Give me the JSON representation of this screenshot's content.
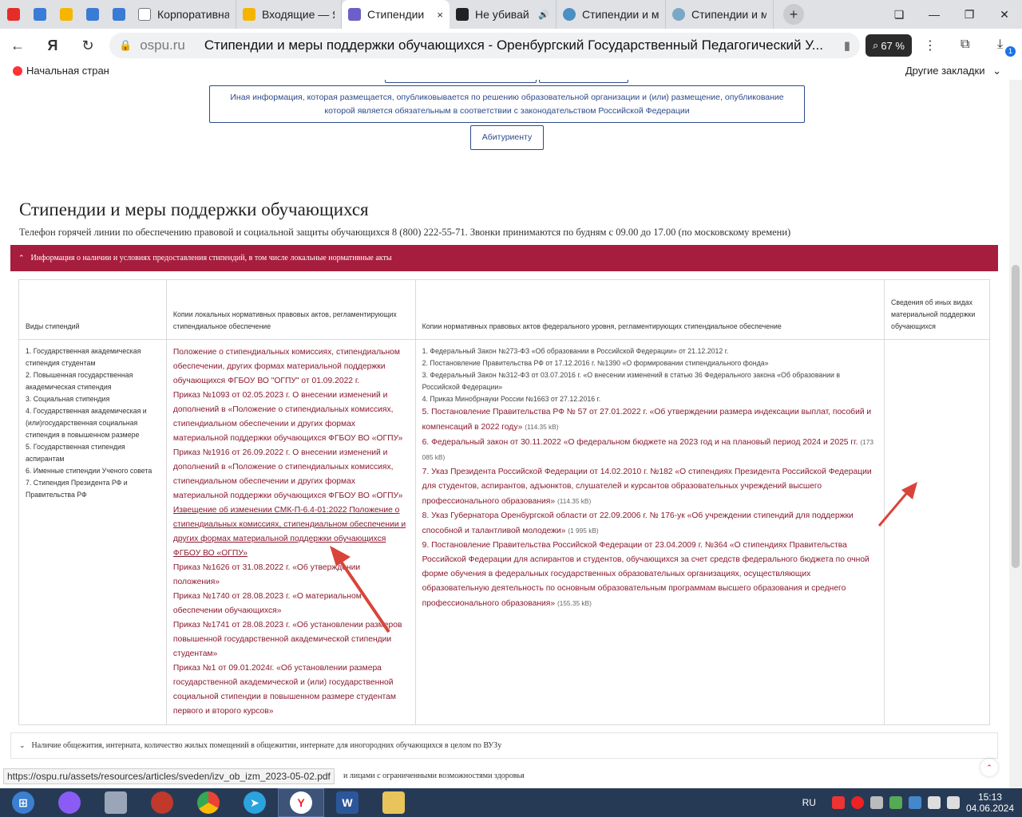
{
  "tabs": [
    {
      "title": "Корпоративна",
      "icon": "corporate-icon"
    },
    {
      "title": "Входящие — Я",
      "icon": "mail-icon"
    },
    {
      "title": "Стипендии",
      "icon": "ospu-icon",
      "close": "×"
    },
    {
      "title": "Не убивай",
      "icon": "video-icon"
    },
    {
      "title": "Стипендии и м",
      "icon": "scholarship-icon"
    },
    {
      "title": "Стипендии и м",
      "icon": "scholarship-icon"
    }
  ],
  "new_tab": "+",
  "window_controls": {
    "minimize": "—",
    "maximize": "❐",
    "close": "✕"
  },
  "address": {
    "domain": "ospu.ru",
    "title": "Стипендии и меры поддержки обучающихся - Оренбургский Государственный Педагогический У...",
    "zoom": "67 %"
  },
  "downloads_count": "1",
  "bookmarks": {
    "home": "Начальная стран",
    "other": "Другие закладки"
  },
  "page": {
    "nav_other_info": "Иная информация, которая размещается, опубликовывается по решению образовательной организации и (или) размещение, опубликование которой является обязательным в соответствии с законодательством Российской Федерации",
    "nav_applicant": "Абитуриенту",
    "title": "Стипендии и меры поддержки обучающихся",
    "hotline": "Телефон горячей линии по обеспечению правовой и социальной защиты обучающихся 8 (800) 222-55-71. Звонки принимаются по будням с 09.00 до 17.00 (по московскому времени)",
    "accordion_open": "Информация о наличии и условиях предоставления стипендий, в том числе локальные нормативные акты",
    "accordion_dorm": "Наличие общежития, интерната, количество жилых помещений в общежитии, интернате для иногородних обучающихся в целом по ВУЗу",
    "accordion_next": "и лицами с ограниченными возможностями здоровья",
    "table": {
      "headers": [
        "Виды стипендий",
        "Копии локальных нормативных правовых актов, регламентирующих стипендиальное обеспечение",
        "Копии нормативных правовых актов федерального уровня, регламентирующих стипендиальное обеспечение",
        "Сведения об иных видах материальной поддержки обучающихся"
      ],
      "types": [
        "1. Государственная академическая стипендия студентам",
        "2. Повышенная государственная академическая стипендия",
        "3. Социальная стипендия",
        "4. Государственная академическая и (или)государственная социальная стипендия в повышенном размере",
        "5. Государственная стипендия аспирантам",
        "6. Именные стипендии Ученого совета",
        "7. Стипендия Президента РФ и Правительства РФ"
      ],
      "local_acts": [
        {
          "text": "Положение о стипендиальных комиссиях, стипендиальном обеспечении, других формах материальной поддержки обучающихся ФГБОУ ВО \"ОГПУ\" от 01.09.2022 г."
        },
        {
          "text": "Приказ №1093 от 02.05.2023 г. О внесении изменений и дополнений в «Положение о стипендиальных комиссиях, стипендиальном обеспечении и других формах материальной поддержки обучающихся ФГБОУ ВО «ОГПУ»"
        },
        {
          "text": "Приказ №1916 от 26.09.2022 г. О внесении изменений и дополнений в «Положение о стипендиальных комиссиях, стипендиальном обеспечении и других формах материальной поддержки обучающихся ФГБОУ ВО «ОГПУ»"
        },
        {
          "text": "Извещение об изменении СМК-П-6.4-01:2022 Положение о стипендиальных комиссиях, стипендиальном обеспечении и других формах материальной поддержки обучающихся ФГБОУ ВО «ОГПУ»",
          "link": true
        },
        {
          "text": "Приказ №1626 от 31.08.2022 г. «Об утверждении положения»"
        },
        {
          "text": "Приказ №1740 от 28.08.2023 г. «О материальном обеспечении обучающихся»"
        },
        {
          "text": "Приказ №1741 от 28.08.2023 г. «Об установлении размеров повышенной государственной академической стипендии студентам»"
        },
        {
          "text": "Приказ №1 от 09.01.2024г. «Об установлении размера государственной академической и (или) государственной социальной стипендии в повышенном размере студентам первого и второго курсов»"
        }
      ],
      "federal_small": [
        "1. Федеральный Закон №273-ФЗ «Об образовании в Российской Федерации» от 21.12.2012 г.",
        "2. Постановление Правительства РФ от 17.12.2016 г. №1390 «О формировании стипендиального фонда»",
        "3. Федеральный Закон №312-ФЗ от 03.07.2016 г. «О внесении изменений в статью 36 Федерального закона «Об образовании в Российской Федерации»",
        "4. Приказ Минобрнауки России №1663 от 27.12.2016 г."
      ],
      "federal_links": [
        {
          "text": "5. Постановление Правительства РФ № 57 от 27.01.2022 г. «Об утверждении размера индексации выплат, пособий и компенсаций в 2022 году»",
          "size": "(114.35 kB)"
        },
        {
          "text": "6. Федеральный закон от 30.11.2022 «О федеральном бюджете на 2023 год и на плановый период 2024 и 2025 гг.",
          "size": "(173 085 kB)"
        },
        {
          "text": "7. Указ Президента Российской Федерации от 14.02.2010 г. №182 «О стипендиях Президента Российской Федерации для студентов, аспирантов, адъюнктов, слушателей и курсантов образовательных учреждений высшего профессионального образования»",
          "size": "(114.35 kB)"
        },
        {
          "text": "8. Указ Губернатора Оренбургской области от 22.09.2006 г. № 176-ук «Об учреждении стипендий для поддержки способной и талантливой молодежи»",
          "size": "(1 995 kB)"
        },
        {
          "text": "9. Постановление Правительства Российской Федерации от 23.04.2009 г. №364 «О стипендиях Правительства Российской Федерации для аспирантов и студентов, обучающихся за счет средств федерального бюджета по очной форме обучения в федеральных государственных образовательных организациях, осуществляющих образовательную деятельность по основным образовательным программам высшего образования и среднего профессионального образования»",
          "size": "(155.35 kB)"
        }
      ]
    }
  },
  "status_url": "https://ospu.ru/assets/resources/articles/sveden/izv_ob_izm_2023-05-02.pdf",
  "taskbar": {
    "lang": "RU",
    "time": "15:13",
    "date": "04.06.2024"
  },
  "colors": {
    "accent": "#a71d3d",
    "link": "#8b1a2e",
    "nav_border": "#2d4a8a",
    "annotation_arrow": "#d9443a"
  }
}
